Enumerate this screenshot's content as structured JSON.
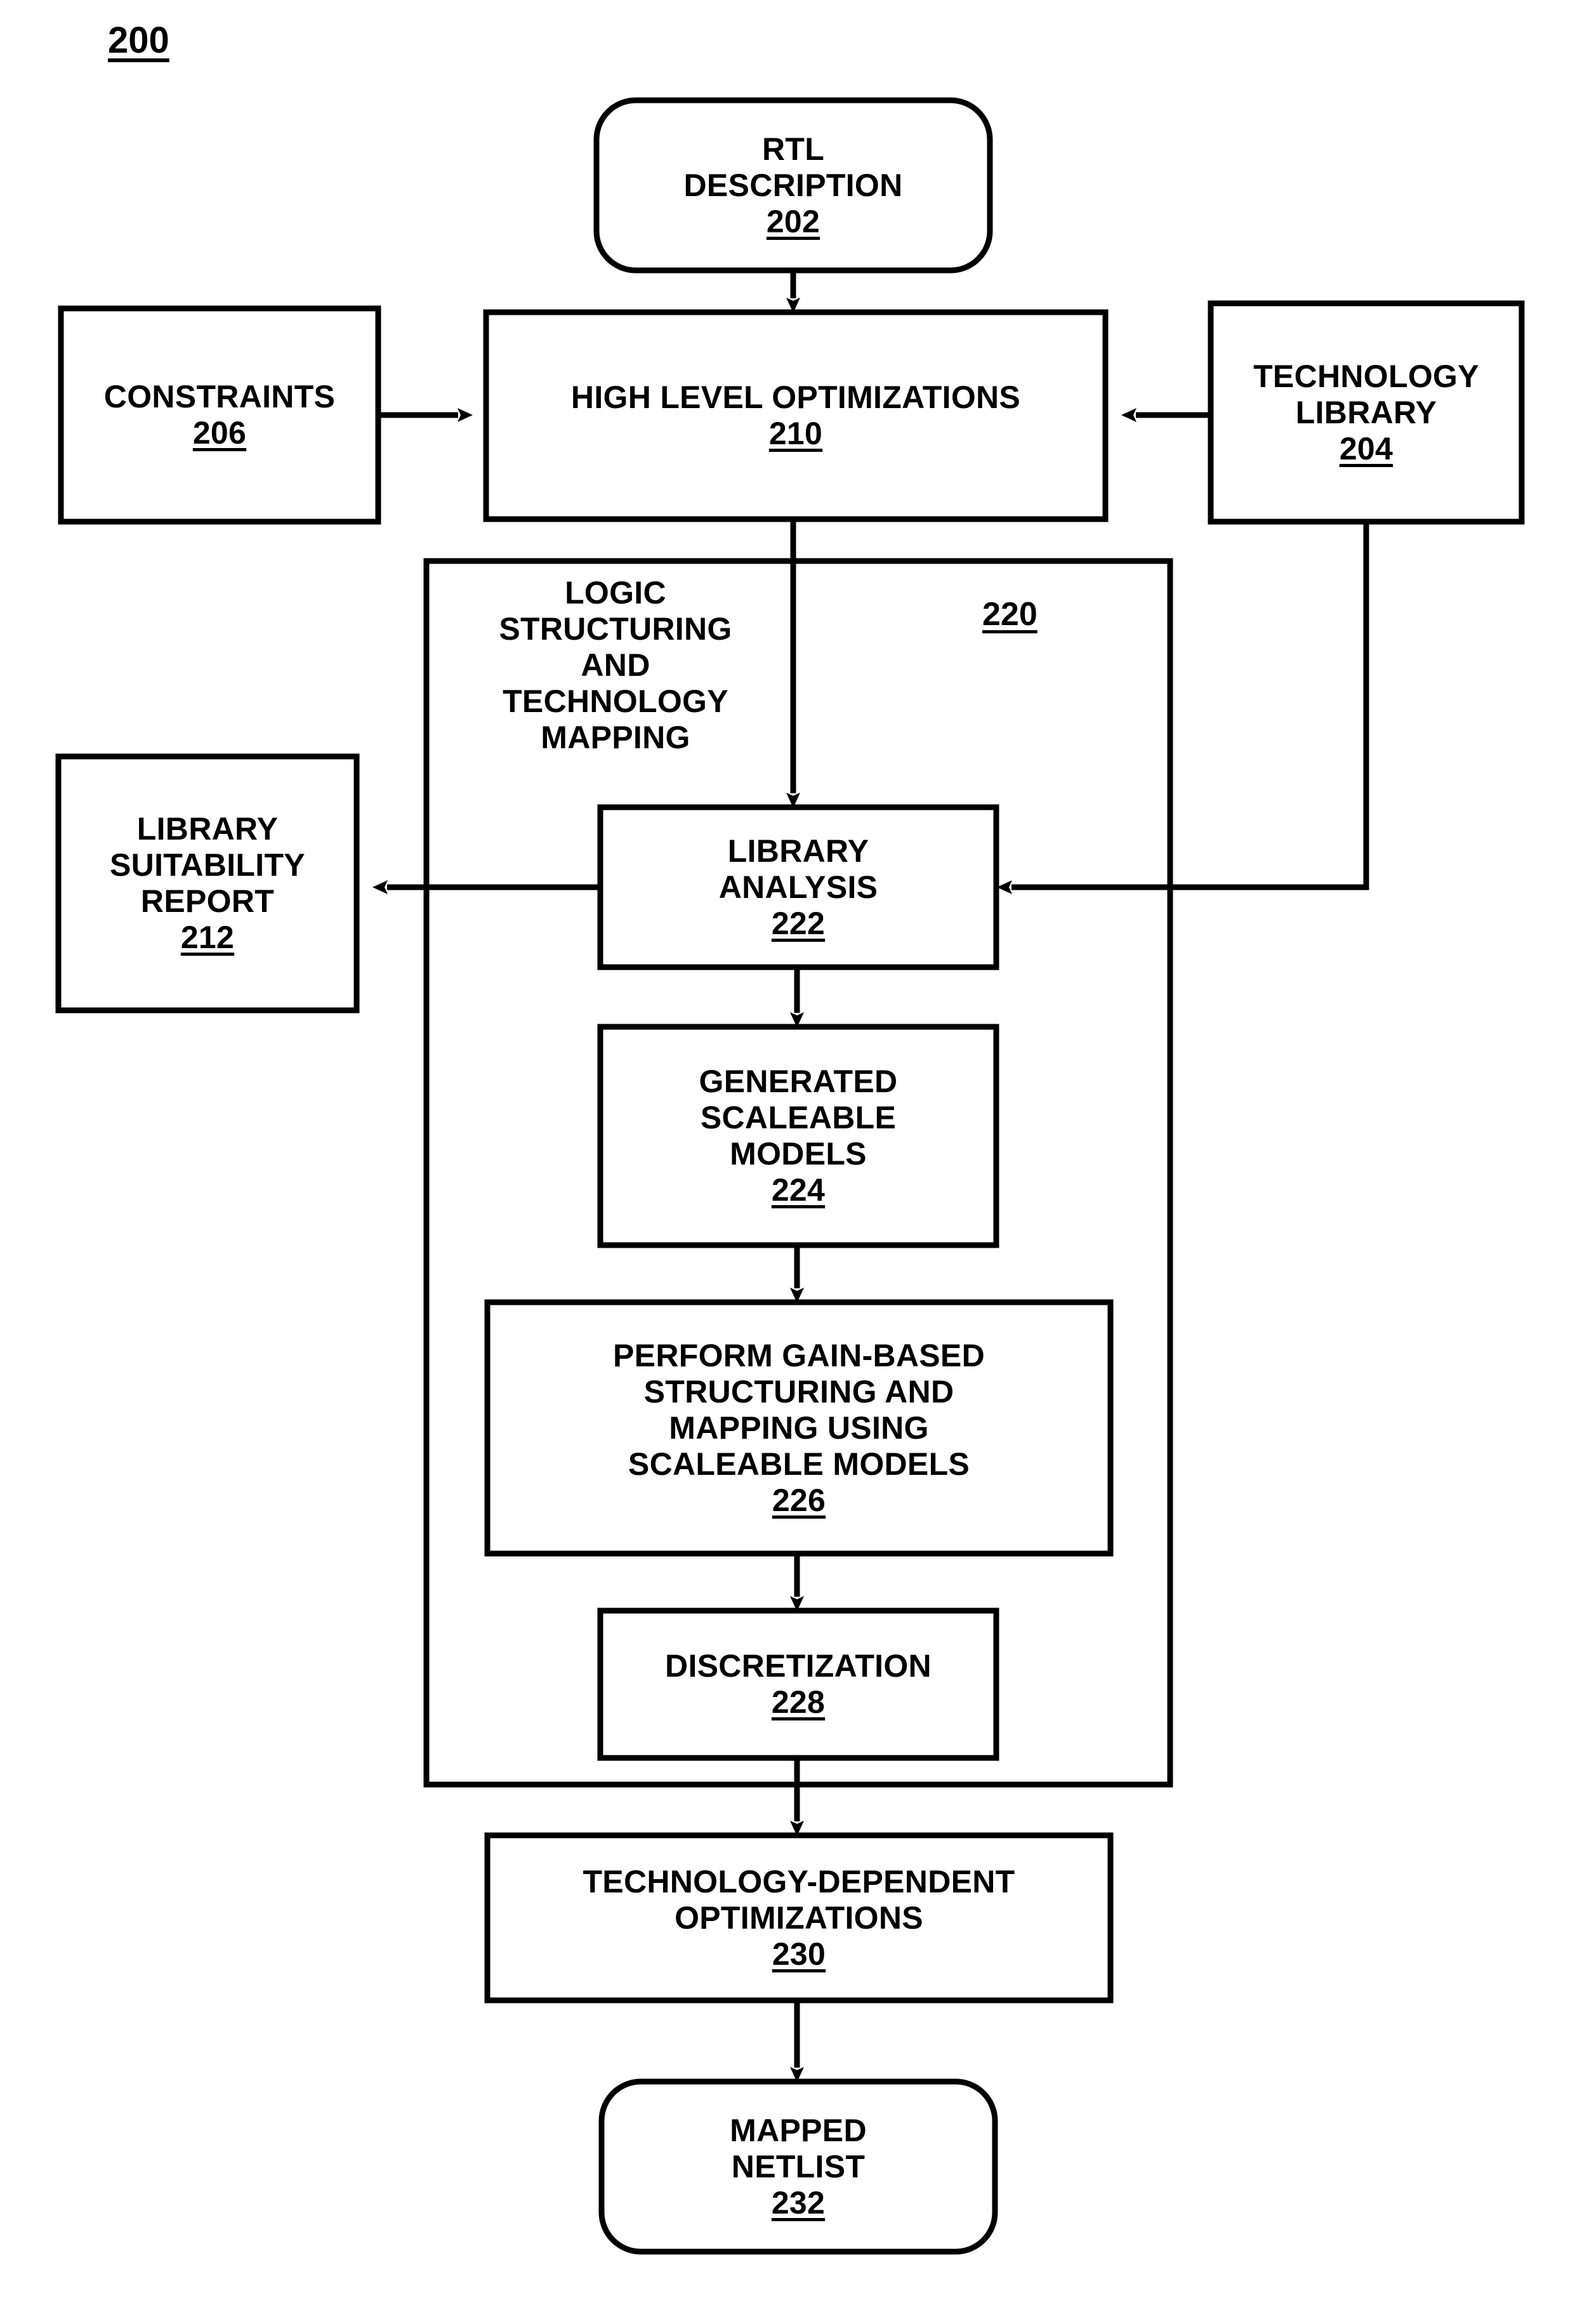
{
  "figure": {
    "number": "200",
    "type": "flowchart",
    "background_color": "#ffffff",
    "line_color": "#000000"
  },
  "nodes": {
    "rtl_description": {
      "shape": "rounded-rectangle",
      "lines": [
        "RTL",
        "DESCRIPTION"
      ],
      "ref": "202"
    },
    "constraints": {
      "shape": "rectangle",
      "lines": [
        "CONSTRAINTS"
      ],
      "ref": "206"
    },
    "high_level_optimizations": {
      "shape": "rectangle",
      "lines": [
        "HIGH LEVEL OPTIMIZATIONS"
      ],
      "ref": "210"
    },
    "technology_library": {
      "shape": "rectangle",
      "lines": [
        "TECHNOLOGY",
        "LIBRARY"
      ],
      "ref": "204"
    },
    "logic_structuring_group": {
      "shape": "rectangle-container",
      "lines": [
        "LOGIC",
        "STRUCTURING",
        "AND",
        "TECHNOLOGY",
        "MAPPING"
      ],
      "ref": "220"
    },
    "library_suitability_report": {
      "shape": "rectangle",
      "lines": [
        "LIBRARY",
        "SUITABILITY",
        "REPORT"
      ],
      "ref": "212"
    },
    "library_analysis": {
      "shape": "rectangle",
      "lines": [
        "LIBRARY",
        "ANALYSIS"
      ],
      "ref": "222"
    },
    "generated_scaleable_models": {
      "shape": "rectangle",
      "lines": [
        "GENERATED",
        "SCALEABLE",
        "MODELS"
      ],
      "ref": "224"
    },
    "gain_based_structuring": {
      "shape": "rectangle",
      "lines": [
        "PERFORM GAIN-BASED",
        "STRUCTURING AND",
        "MAPPING USING",
        "SCALEABLE MODELS"
      ],
      "ref": "226"
    },
    "discretization": {
      "shape": "rectangle",
      "lines": [
        "DISCRETIZATION"
      ],
      "ref": "228"
    },
    "technology_dependent_optimizations": {
      "shape": "rectangle",
      "lines": [
        "TECHNOLOGY-DEPENDENT",
        "OPTIMIZATIONS"
      ],
      "ref": "230"
    },
    "mapped_netlist": {
      "shape": "rounded-rectangle",
      "lines": [
        "MAPPED",
        "NETLIST"
      ],
      "ref": "232"
    }
  },
  "connections": [
    {
      "from": "rtl_description",
      "to": "high_level_optimizations",
      "direction": "down"
    },
    {
      "from": "constraints",
      "to": "high_level_optimizations",
      "direction": "right"
    },
    {
      "from": "technology_library",
      "to": "high_level_optimizations",
      "direction": "left"
    },
    {
      "from": "high_level_optimizations",
      "to": "library_analysis",
      "direction": "down"
    },
    {
      "from": "technology_library",
      "to": "library_analysis",
      "direction": "left"
    },
    {
      "from": "library_analysis",
      "to": "library_suitability_report",
      "direction": "left"
    },
    {
      "from": "library_analysis",
      "to": "generated_scaleable_models",
      "direction": "down"
    },
    {
      "from": "generated_scaleable_models",
      "to": "gain_based_structuring",
      "direction": "down"
    },
    {
      "from": "gain_based_structuring",
      "to": "discretization",
      "direction": "down"
    },
    {
      "from": "discretization",
      "to": "technology_dependent_optimizations",
      "direction": "down"
    },
    {
      "from": "technology_dependent_optimizations",
      "to": "mapped_netlist",
      "direction": "down"
    }
  ]
}
